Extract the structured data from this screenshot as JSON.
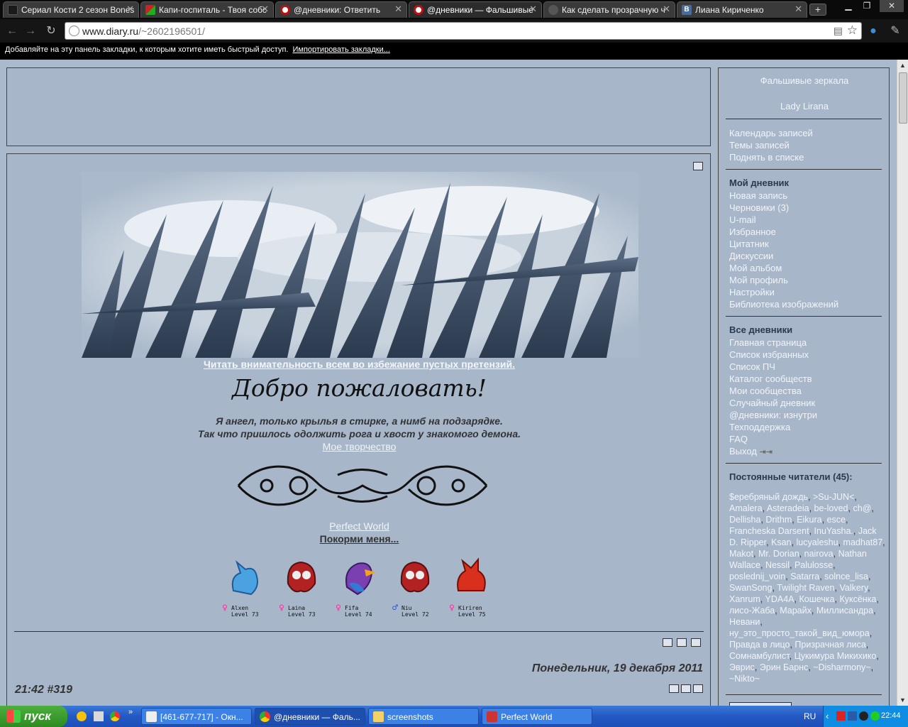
{
  "browser": {
    "tabs": [
      {
        "title": "Сериал Кости 2 сезон Bones"
      },
      {
        "title": "Капи-госпиталь - Твоя собс"
      },
      {
        "title": "@дневники: Ответить"
      },
      {
        "title": "@дневники — Фальшивые"
      },
      {
        "title": "Как сделать прозрачную ч"
      },
      {
        "title": "Лиана Кириченко"
      }
    ],
    "address_host": "www.diary.ru",
    "address_path": "/~2602196501/",
    "bookmarks_prompt": "Добавляйте на эту панель закладки, к которым хотите иметь быстрый доступ.",
    "bookmarks_import": "Импортировать закладки..."
  },
  "post": {
    "rules_link": "Читать внимательность всем во избежание пустых претензий.",
    "welcome": "Добро пожаловать!",
    "quote_line1": "Я ангел, только крылья в стирке, а нимб на подзарядке.",
    "quote_line2": "Так что пришлось одолжить рога и хвост у знакомого демона.",
    "creativity_link": "Мое творчество",
    "game_link": "Perfect World",
    "feed_link": "Покорми меня...",
    "pets": [
      {
        "name": "Alxen",
        "level": "Level 73",
        "gender": "♀"
      },
      {
        "name": "Laina",
        "level": "Level 73",
        "gender": "♀"
      },
      {
        "name": "Fifa",
        "level": "Level 74",
        "gender": "♀"
      },
      {
        "name": "Niu",
        "level": "Level 72",
        "gender": "♂"
      },
      {
        "name": "Kiriren",
        "level": "Level 75",
        "gender": "♀"
      }
    ],
    "date": "Понедельник, 19 декабря 2011",
    "time": "21:42 #319"
  },
  "sidebar": {
    "diary_title": "Фальшивые зеркала",
    "author": "Lady Lirana",
    "links1": [
      "Календарь записей",
      "Темы записей",
      "Поднять в списке"
    ],
    "my_diary_header": "Мой дневник",
    "links2": [
      "Новая запись",
      "Черновики (3)",
      "U-mail",
      "Избранное",
      "Цитатник",
      "Дискуссии",
      "Мой альбом",
      "Мой профиль",
      "Настройки",
      "Библиотека изображений"
    ],
    "all_diaries_header": "Все дневники",
    "links3": [
      "Главная страница",
      "Список избранных",
      "Список ПЧ",
      "Каталог сообществ",
      "Мои сообщества",
      "Случайный дневник",
      "@дневники: изнутри",
      "Техподдержка",
      "FAQ",
      "Выход"
    ],
    "readers_header": "Постоянные читатели (45):",
    "readers": [
      "$еребряный дождь",
      ">Su-JUN<",
      "Amalera",
      "Asteradeia",
      "be-loved",
      "ch@",
      "Dellisha",
      "Drithm",
      "Eikura",
      "esce",
      "Francheska Darsent",
      "InuYasha.",
      "Jack D. Ripper",
      "Ksan",
      "lucyaleshu",
      "madhat87",
      "Makot",
      "Mr. Dorian",
      "nairova",
      "Nathan Wallace",
      "Nessil",
      "Palulosse",
      "poslednij_voin",
      "Satarra",
      "solnce_lisa",
      "SwanSong",
      "Twilight Raven",
      "Valkery",
      "Xanrum",
      "YDA4A",
      "Кошечка",
      "Куксёнка",
      "лисо-Жаба",
      "Марайх",
      "Миллисандра",
      "Невани",
      "ну_это_просто_такой_вид_юмора",
      "Правда в лицо",
      "Призрачная лиса",
      "Сомнамбулист",
      "Цукимура Микихико",
      "Эврис",
      "Эрин Барнс",
      "~Disharmony~",
      "~Nikto~"
    ]
  },
  "taskbar": {
    "start": "пуск",
    "tasks": [
      "[461-677-717] - Окн...",
      "@дневники — Фаль...",
      "screenshots",
      "Perfect World"
    ],
    "lang": "RU",
    "clock": "22:44"
  },
  "colors": {
    "page_bg": "#aab9cb",
    "panel_border": "#444444",
    "link_light": "#f2f5f9",
    "text_dark": "#333333"
  }
}
